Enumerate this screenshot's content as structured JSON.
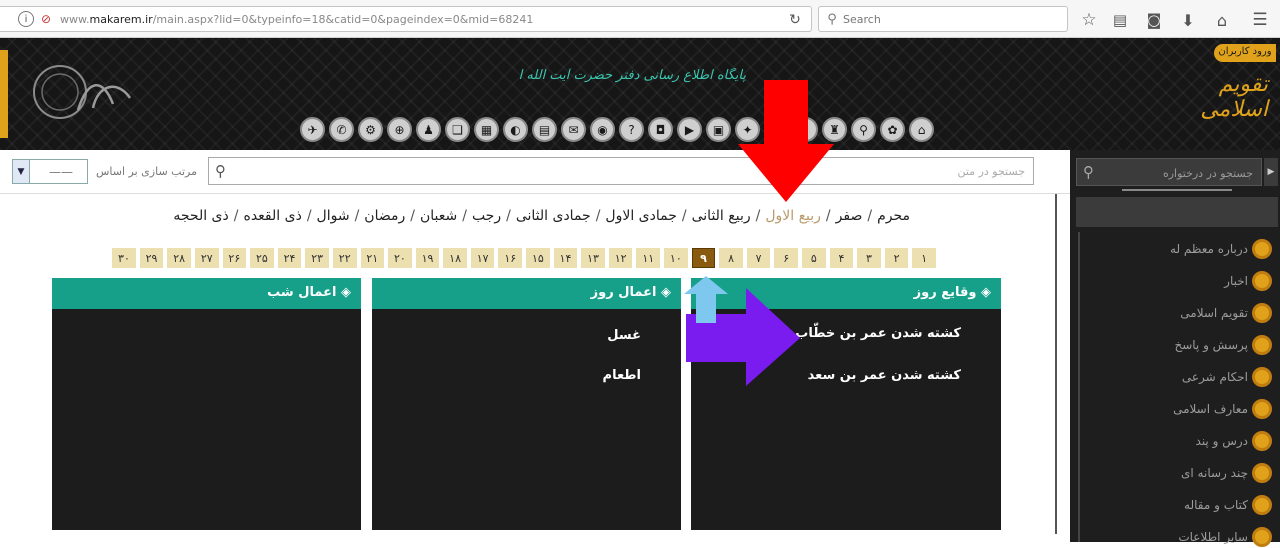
{
  "browser": {
    "url_prefix": "www.",
    "url_domain": "makarem.ir",
    "url_path": "/main.aspx?lid=0&typeinfo=18&catid=0&pageindex=0&mid=68241",
    "search_placeholder": "Search"
  },
  "banner": {
    "users_badge": "ورود کاربران",
    "logo_text": "تقویم اسلامی",
    "site_title": "پایگاه اطلاع رسانی دفتر حضرت آیت الله العظمی مکارم شیرازی",
    "calligraphy_right": "مکارم شیرازی"
  },
  "toolbar": {
    "sort_label": "مرتب سازی بر اساس",
    "sort_value": "——",
    "search_placeholder": "جستجو در متن"
  },
  "months": [
    {
      "label": "محرم",
      "active": false
    },
    {
      "label": "صفر",
      "active": false
    },
    {
      "label": "ربیع الاول",
      "active": true
    },
    {
      "label": "ربیع الثانی",
      "active": false
    },
    {
      "label": "جمادی الاول",
      "active": false
    },
    {
      "label": "جمادی الثانی",
      "active": false
    },
    {
      "label": "رجب",
      "active": false
    },
    {
      "label": "شعبان",
      "active": false
    },
    {
      "label": "رمضان",
      "active": false
    },
    {
      "label": "شوال",
      "active": false
    },
    {
      "label": "ذی القعده",
      "active": false
    },
    {
      "label": "ذی الحجه",
      "active": false
    }
  ],
  "days": [
    "۱",
    "۲",
    "۳",
    "۴",
    "۵",
    "۶",
    "۷",
    "۸",
    "۹",
    "۱۰",
    "۱۱",
    "۱۲",
    "۱۳",
    "۱۴",
    "۱۵",
    "۱۶",
    "۱۷",
    "۱۸",
    "۱۹",
    "۲۰",
    "۲۱",
    "۲۲",
    "۲۳",
    "۲۴",
    "۲۵",
    "۲۶",
    "۲۷",
    "۲۸",
    "۲۹",
    "۳۰"
  ],
  "active_day": "۹",
  "panels": {
    "events": {
      "title": "وقایع روز",
      "items": [
        "کشته شدن عمر بن خطّاب",
        "کشته شدن عمر بن سعد"
      ]
    },
    "day_deeds": {
      "title": "اعمال روز",
      "items": [
        "غسل",
        "اطعام"
      ]
    },
    "night_deeds": {
      "title": "اعمال شب",
      "items": []
    }
  },
  "sidebar": {
    "search_placeholder": "جستجو در درختواره",
    "items": [
      "درباره معظم له",
      "اخبار",
      "تقویم اسلامی",
      "پرسش و پاسخ",
      "احکام شرعی",
      "معارف اسلامی",
      "درس و پند",
      "چند رسانه ای",
      "کتاب و مقاله",
      "سایر اطلاعات"
    ]
  },
  "colors": {
    "accent_gold": "#e0a21b",
    "panel_header": "#16a08a",
    "active_day": "#8a5a10",
    "annotation_red": "#ff0000",
    "annotation_purple": "#7a1cf0",
    "annotation_blue": "#7ec8f0"
  }
}
